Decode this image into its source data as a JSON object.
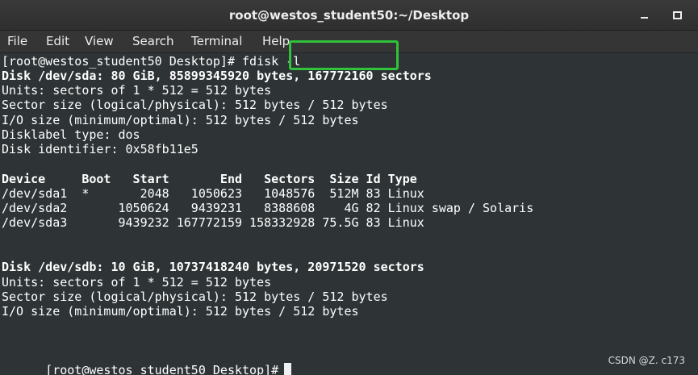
{
  "window": {
    "title": "root@westos_student50:~/Desktop"
  },
  "menu": {
    "items": [
      "File",
      "Edit",
      "View",
      "Search",
      "Terminal",
      "Help"
    ]
  },
  "terminal": {
    "lines": [
      {
        "text": "[root@westos_student50 Desktop]# fdisk -l",
        "bold": false
      },
      {
        "text": "Disk /dev/sda: 80 GiB, 85899345920 bytes, 167772160 sectors",
        "bold": true
      },
      {
        "text": "Units: sectors of 1 * 512 = 512 bytes",
        "bold": false
      },
      {
        "text": "Sector size (logical/physical): 512 bytes / 512 bytes",
        "bold": false
      },
      {
        "text": "I/O size (minimum/optimal): 512 bytes / 512 bytes",
        "bold": false
      },
      {
        "text": "Disklabel type: dos",
        "bold": false
      },
      {
        "text": "Disk identifier: 0x58fb11e5",
        "bold": false
      },
      {
        "text": "",
        "bold": false
      },
      {
        "text": "Device     Boot   Start       End   Sectors  Size Id Type",
        "bold": true
      },
      {
        "text": "/dev/sda1  *       2048   1050623   1048576  512M 83 Linux",
        "bold": false
      },
      {
        "text": "/dev/sda2       1050624   9439231   8388608    4G 82 Linux swap / Solaris",
        "bold": false
      },
      {
        "text": "/dev/sda3       9439232 167772159 158332928 75.5G 83 Linux",
        "bold": false
      },
      {
        "text": "",
        "bold": false
      },
      {
        "text": "",
        "bold": false
      },
      {
        "text": "Disk /dev/sdb: 10 GiB, 10737418240 bytes, 20971520 sectors",
        "bold": true
      },
      {
        "text": "Units: sectors of 1 * 512 = 512 bytes",
        "bold": false
      },
      {
        "text": "Sector size (logical/physical): 512 bytes / 512 bytes",
        "bold": false
      },
      {
        "text": "I/O size (minimum/optimal): 512 bytes / 512 bytes",
        "bold": false
      },
      {
        "text": "",
        "bold": false
      },
      {
        "text": "",
        "bold": false
      },
      {
        "text": "[root@westos_student50 Desktop]#",
        "bold": false
      }
    ]
  },
  "watermark": {
    "text": "CSDN @Z. c173"
  },
  "colors": {
    "terminal_background": "#2e3436",
    "highlight": "#2fc23a"
  },
  "icons": [
    "minimize-icon",
    "maximize-icon"
  ]
}
